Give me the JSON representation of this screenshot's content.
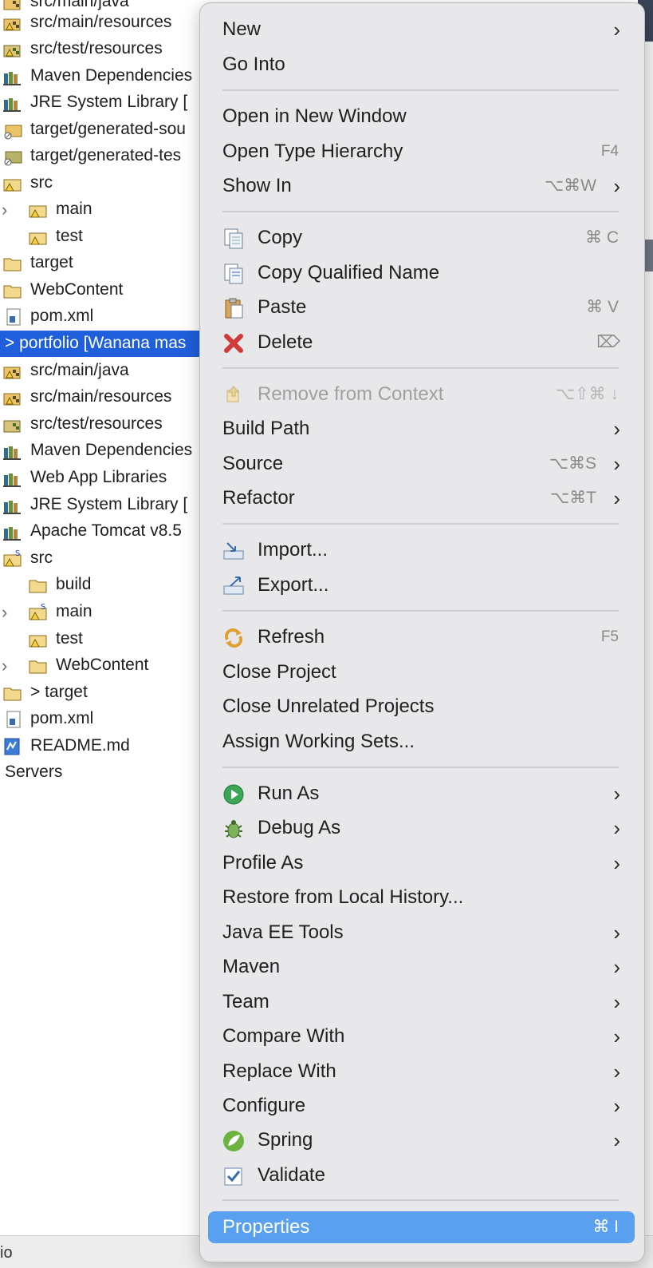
{
  "explorer": {
    "rows": [
      {
        "label": "src/main/java"
      },
      {
        "label": "src/main/resources"
      },
      {
        "label": "src/test/resources"
      },
      {
        "label": "Maven Dependencies"
      },
      {
        "label": "JRE System Library ["
      },
      {
        "label": "target/generated-sou"
      },
      {
        "label": "target/generated-tes"
      },
      {
        "label": "src"
      },
      {
        "label": "main"
      },
      {
        "label": "test"
      },
      {
        "label": "target"
      },
      {
        "label": "WebContent"
      },
      {
        "label": "pom.xml"
      },
      {
        "label": "> portfolio [Wanana mas"
      },
      {
        "label": "src/main/java"
      },
      {
        "label": "src/main/resources"
      },
      {
        "label": "src/test/resources"
      },
      {
        "label": "Maven Dependencies"
      },
      {
        "label": "Web App Libraries"
      },
      {
        "label": "JRE System Library ["
      },
      {
        "label": "Apache Tomcat v8.5"
      },
      {
        "label": "src"
      },
      {
        "label": "build"
      },
      {
        "label": "main"
      },
      {
        "label": "test"
      },
      {
        "label": "WebContent"
      },
      {
        "label": "> target"
      },
      {
        "label": "pom.xml"
      },
      {
        "label": "README.md"
      },
      {
        "label": "Servers"
      }
    ]
  },
  "status_bar": {
    "text": "io"
  },
  "menu": {
    "items": [
      {
        "label": "New",
        "submenu": "›"
      },
      {
        "label": "Go Into"
      },
      {
        "label": "Open in New Window"
      },
      {
        "label": "Open Type Hierarchy",
        "shortcut": "F4"
      },
      {
        "label": "Show In",
        "shortcut": "⌥⌘W",
        "submenu": "›"
      },
      {
        "label": "Copy",
        "shortcut": "⌘ C",
        "icon": "copy-icon"
      },
      {
        "label": "Copy Qualified Name",
        "icon": "copy-qualified-name-icon"
      },
      {
        "label": "Paste",
        "shortcut": "⌘ V",
        "icon": "paste-icon"
      },
      {
        "label": "Delete",
        "shortcut": "⌦",
        "icon": "delete-icon"
      },
      {
        "label": "Remove from Context",
        "shortcut": "⌥⇧⌘ ↓",
        "icon": "remove-context-icon",
        "disabled": true
      },
      {
        "label": "Build Path",
        "submenu": "›"
      },
      {
        "label": "Source",
        "shortcut": "⌥⌘S",
        "submenu": "›"
      },
      {
        "label": "Refactor",
        "shortcut": "⌥⌘T",
        "submenu": "›"
      },
      {
        "label": "Import...",
        "icon": "import-icon"
      },
      {
        "label": "Export...",
        "icon": "export-icon"
      },
      {
        "label": "Refresh",
        "shortcut": "F5",
        "icon": "refresh-icon"
      },
      {
        "label": "Close Project"
      },
      {
        "label": "Close Unrelated Projects"
      },
      {
        "label": "Assign Working Sets..."
      },
      {
        "label": "Run As",
        "icon": "run-icon",
        "submenu": "›"
      },
      {
        "label": "Debug As",
        "icon": "debug-icon",
        "submenu": "›"
      },
      {
        "label": "Profile As",
        "submenu": "›"
      },
      {
        "label": "Restore from Local History..."
      },
      {
        "label": "Java EE Tools",
        "submenu": "›"
      },
      {
        "label": "Maven",
        "submenu": "›"
      },
      {
        "label": "Team",
        "submenu": "›"
      },
      {
        "label": "Compare With",
        "submenu": "›"
      },
      {
        "label": "Replace With",
        "submenu": "›"
      },
      {
        "label": "Configure",
        "submenu": "›"
      },
      {
        "label": "Spring",
        "icon": "spring-icon",
        "submenu": "›"
      },
      {
        "label": "Validate",
        "icon": "validate-icon"
      },
      {
        "label": "Properties",
        "shortcut": "⌘  I",
        "highlighted": true
      }
    ]
  },
  "colors": {
    "selection": "#1f5fdb",
    "menu_background": "#e8e8ea",
    "menu_highlight": "#5aa0f0"
  }
}
